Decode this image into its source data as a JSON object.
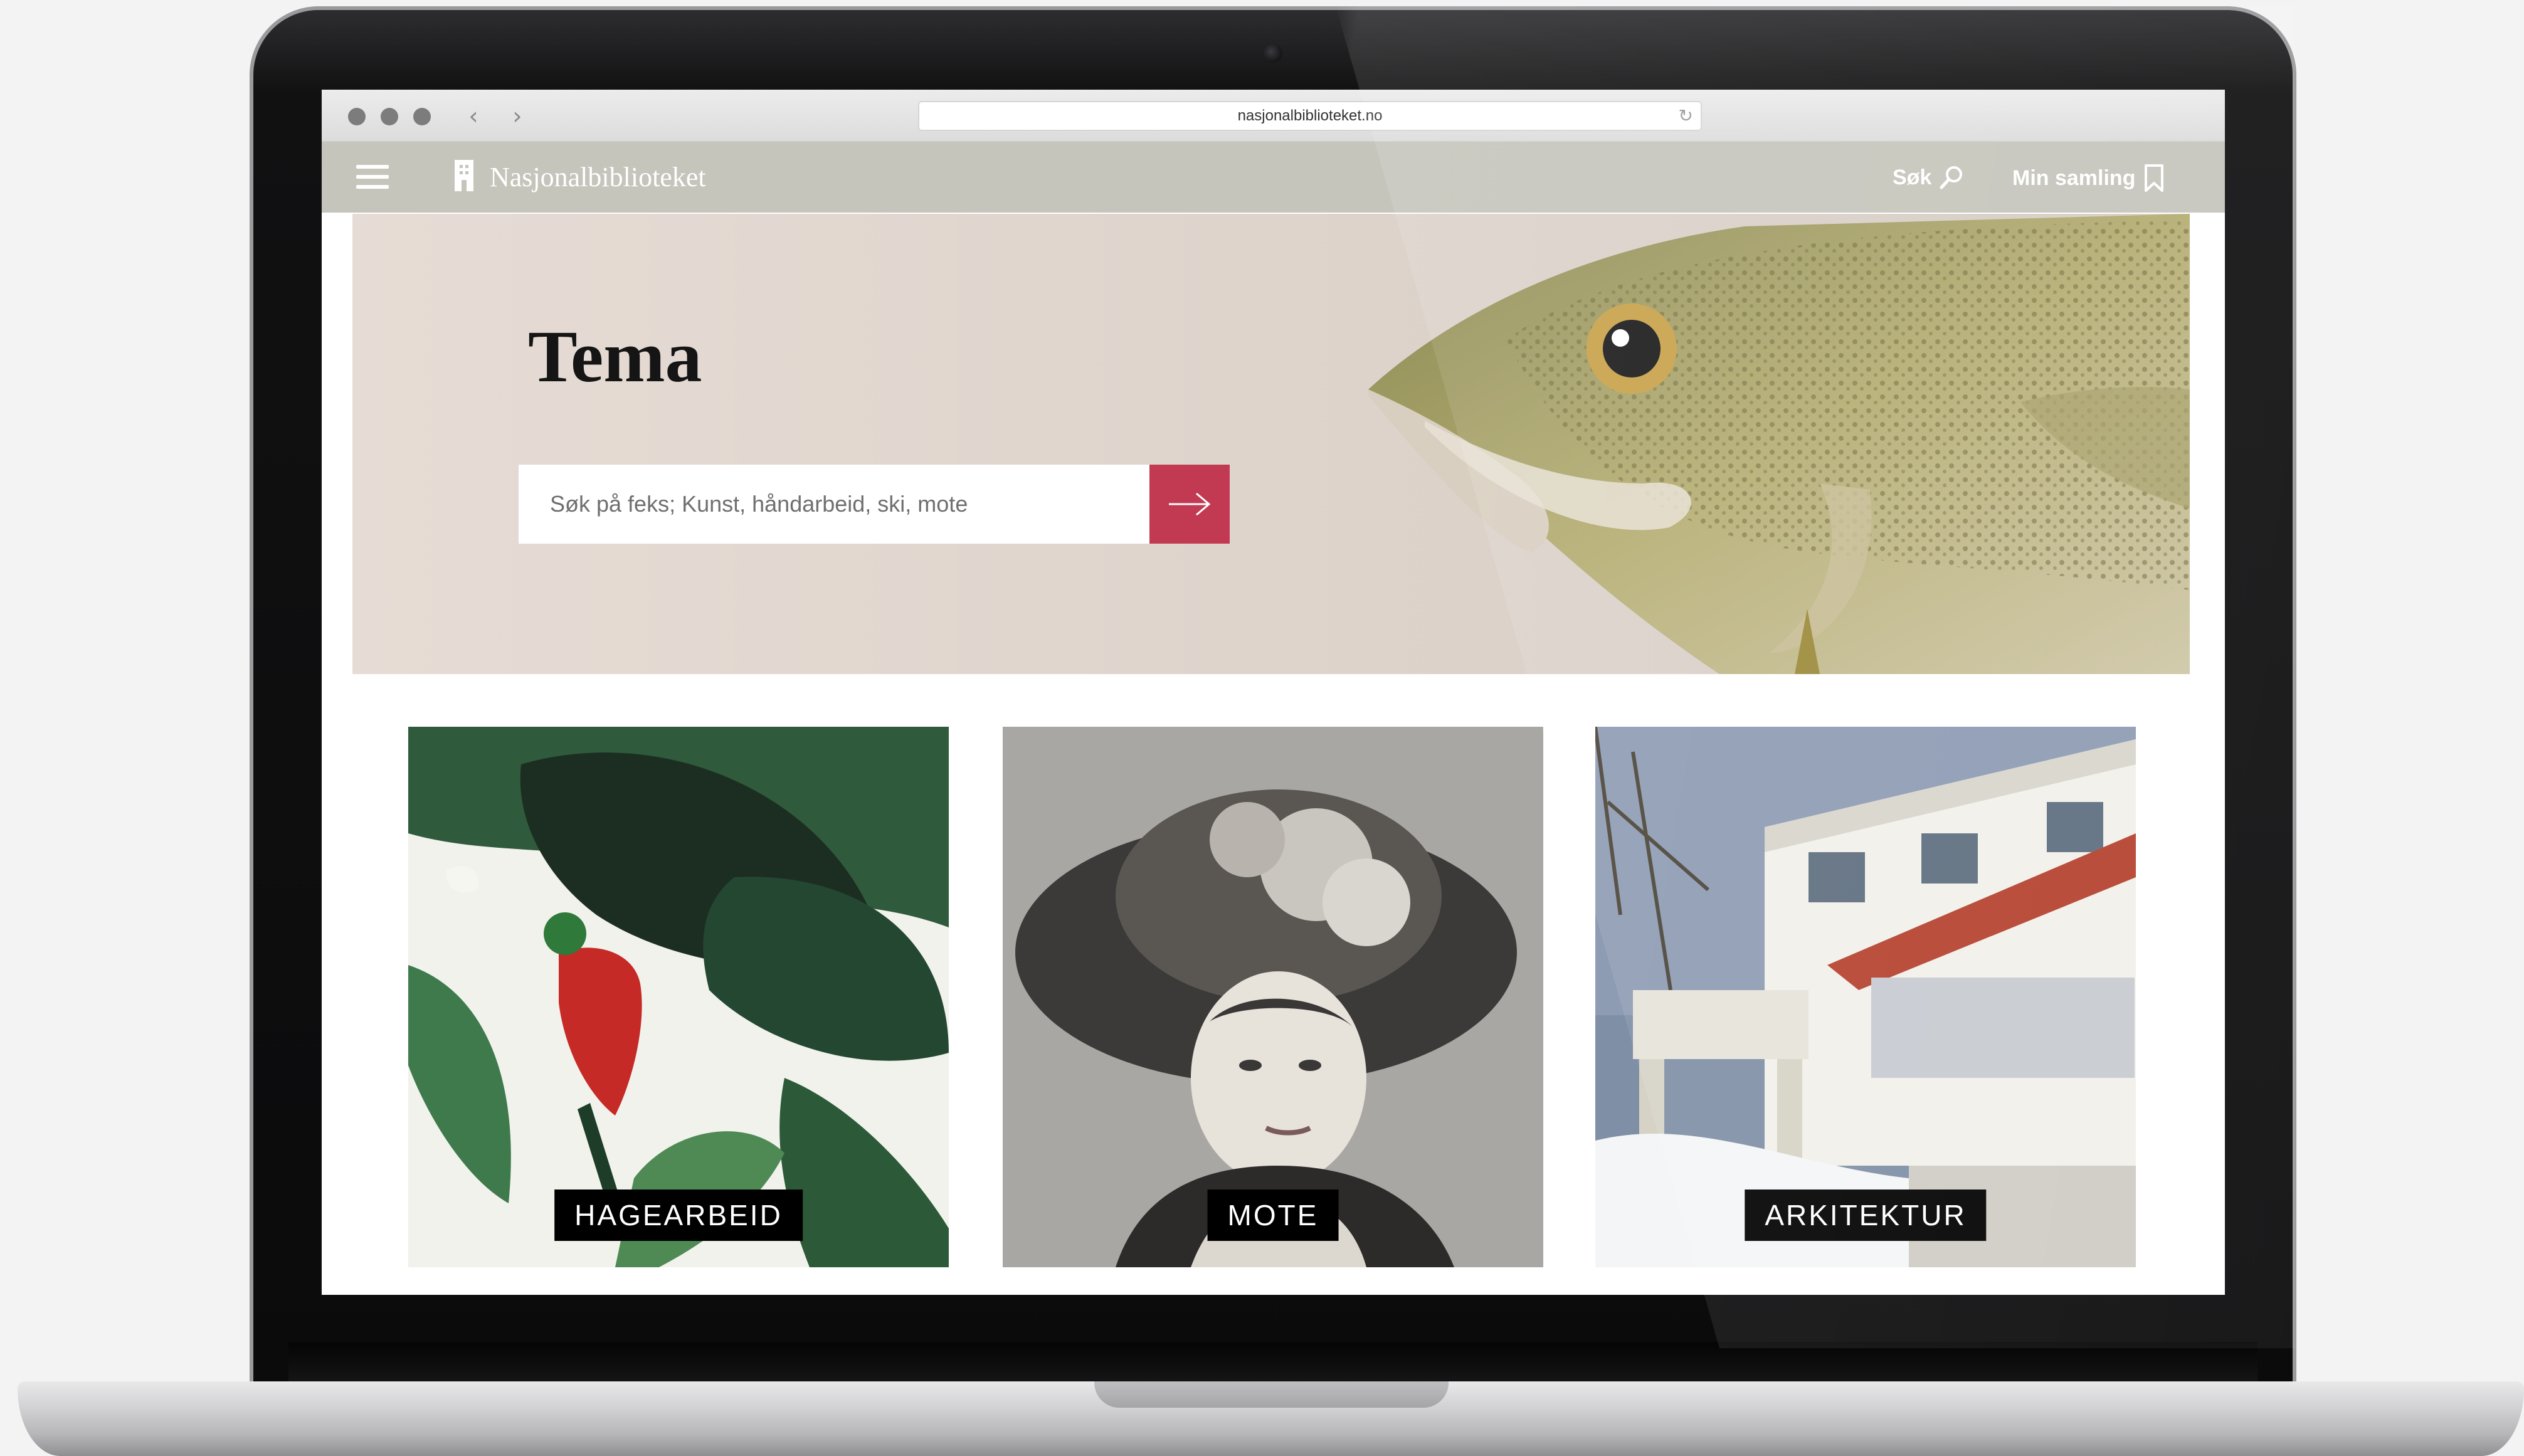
{
  "browser": {
    "url": "nasjonalbiblioteket.no",
    "back_icon": "‹",
    "forward_icon": "›",
    "reload_icon": "↻"
  },
  "header": {
    "logo_text": "Nasjonalbiblioteket",
    "search_label": "Søk",
    "collection_label": "Min samling"
  },
  "hero": {
    "title": "Tema",
    "search_placeholder": "Søk på feks; Kunst, håndarbeid, ski, mote",
    "accent_color": "#c23a52"
  },
  "tiles": [
    {
      "label": "HAGEARBEID",
      "image": "tropical-leaves-bird"
    },
    {
      "label": "MOTE",
      "image": "vintage-hat-portrait"
    },
    {
      "label": "ARKITEKTUR",
      "image": "modernist-building"
    }
  ]
}
